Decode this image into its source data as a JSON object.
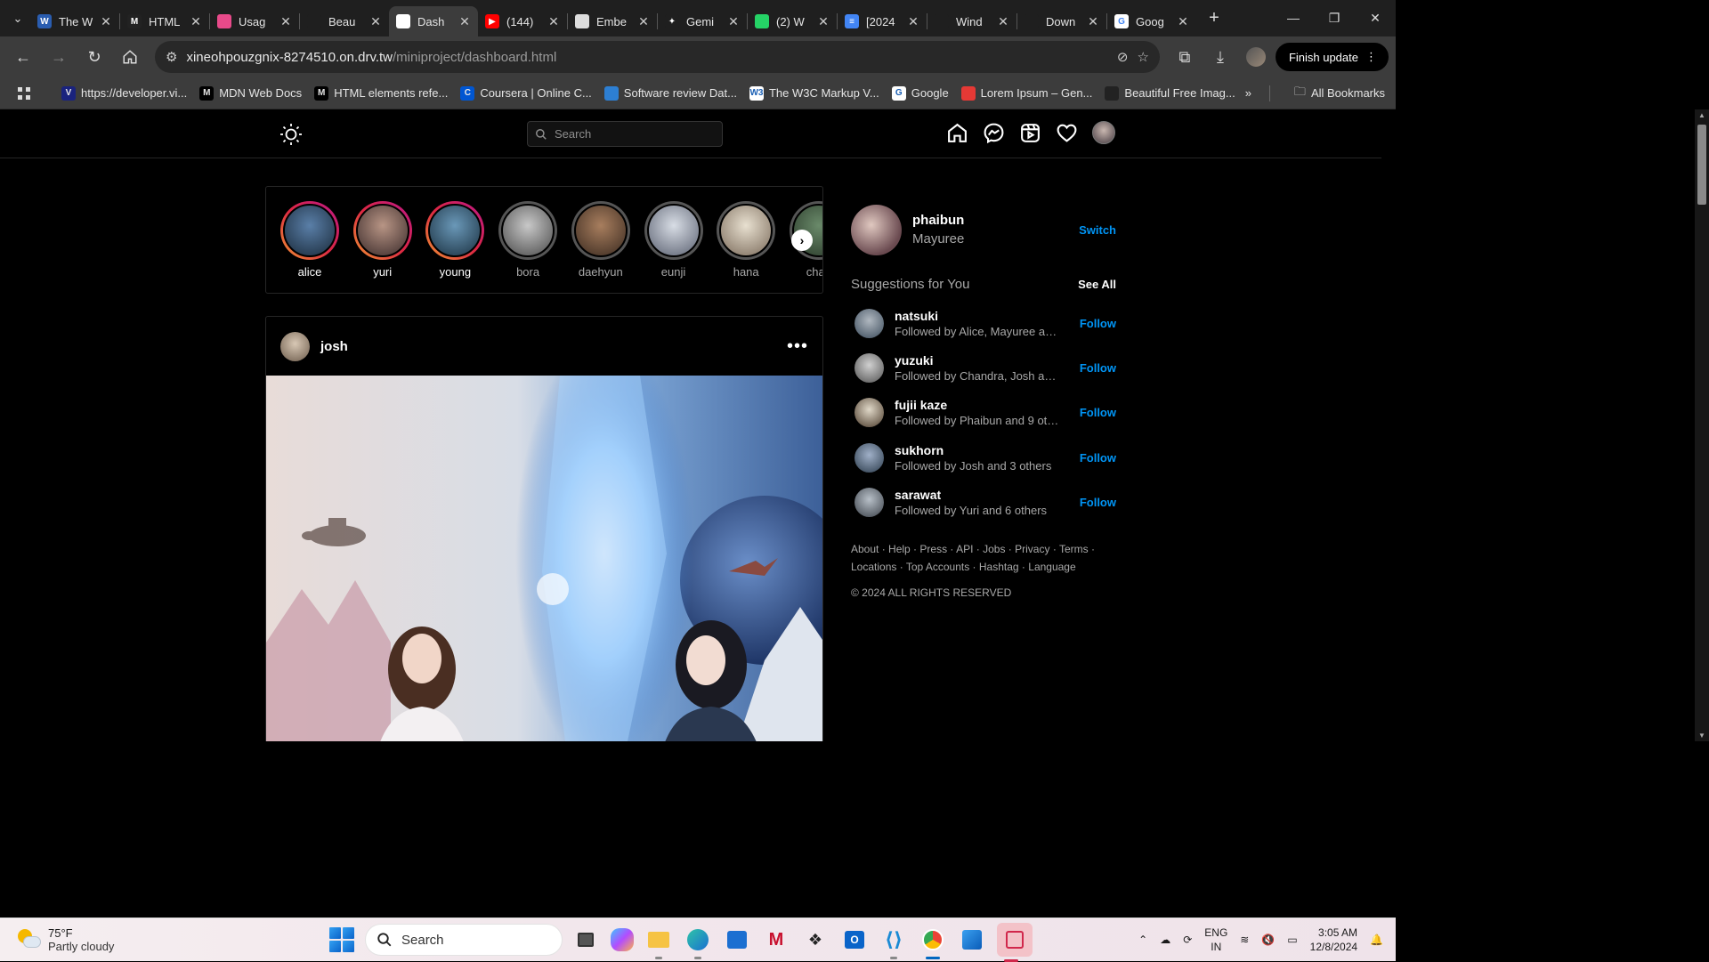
{
  "browser": {
    "tabs": [
      {
        "title": "The W",
        "fav": "W",
        "favcolor": "#2a5db0"
      },
      {
        "title": "HTML",
        "fav": "M",
        "favcolor": "#222"
      },
      {
        "title": "Usag",
        "fav": "",
        "favcolor": "#e84a8a"
      },
      {
        "title": "Beau",
        "fav": "",
        "favcolor": "#1f1f1f"
      },
      {
        "title": "Dash",
        "fav": "",
        "favcolor": "#fff",
        "active": true
      },
      {
        "title": "(144)",
        "fav": "▶",
        "favcolor": "#ff0000"
      },
      {
        "title": "Embe",
        "fav": "",
        "favcolor": "#ddd"
      },
      {
        "title": "Gemi",
        "fav": "✦",
        "favcolor": "#1f1f1f"
      },
      {
        "title": "(2) W",
        "fav": "",
        "favcolor": "#25d366"
      },
      {
        "title": "[2024",
        "fav": "≡",
        "favcolor": "#4285f4"
      },
      {
        "title": "Wind",
        "fav": "",
        "favcolor": "#1f1f1f"
      },
      {
        "title": "Down",
        "fav": "",
        "favcolor": "#1f1f1f"
      },
      {
        "title": "Goog",
        "fav": "G",
        "favcolor": "#fff"
      }
    ],
    "url_host": "xineohpouzgnix-8274510.on.drv.tw",
    "url_path": "/miniproject/dashboard.html",
    "finish_update": "Finish update",
    "bookmarks": [
      {
        "label": "https://developer.vi...",
        "fav": "V",
        "color": "#1a237e"
      },
      {
        "label": "MDN Web Docs",
        "fav": "M",
        "color": "#000"
      },
      {
        "label": "HTML elements refe...",
        "fav": "M",
        "color": "#000"
      },
      {
        "label": "Coursera | Online C...",
        "fav": "C",
        "color": "#0056d2"
      },
      {
        "label": "Software review Dat...",
        "fav": "",
        "color": "#2d7fd3"
      },
      {
        "label": "The W3C Markup V...",
        "fav": "W3",
        "color": "#fff"
      },
      {
        "label": "Google",
        "fav": "G",
        "color": "#fff"
      },
      {
        "label": "Lorem Ipsum – Gen...",
        "fav": "",
        "color": "#e53935"
      },
      {
        "label": "Beautiful Free Imag...",
        "fav": "",
        "color": "#222"
      }
    ],
    "all_bookmarks": "All Bookmarks"
  },
  "app": {
    "search_placeholder": "Search",
    "stories": [
      {
        "name": "alice",
        "seen": false,
        "c1": "#5a7fa8",
        "c2": "#1a2a3a"
      },
      {
        "name": "yuri",
        "seen": false,
        "c1": "#b89585",
        "c2": "#3a2a2a"
      },
      {
        "name": "young",
        "seen": false,
        "c1": "#6a98b8",
        "c2": "#1a3040"
      },
      {
        "name": "bora",
        "seen": true,
        "c1": "#c8c8c8",
        "c2": "#4a4a4a"
      },
      {
        "name": "daehyun",
        "seen": true,
        "c1": "#a87e5e",
        "c2": "#3a2a20"
      },
      {
        "name": "eunji",
        "seen": true,
        "c1": "#d8dde5",
        "c2": "#5a6070"
      },
      {
        "name": "hana",
        "seen": true,
        "c1": "#e8e0d0",
        "c2": "#7a6a5a"
      },
      {
        "name": "chan",
        "seen": true,
        "c1": "#6a8a6a",
        "c2": "#2a3a2a"
      }
    ],
    "post": {
      "user": "josh",
      "more": "•••"
    },
    "me": {
      "username": "phaibun",
      "name": "Mayuree",
      "switch": "Switch"
    },
    "suggestions_title": "Suggestions for You",
    "see_all": "See All",
    "suggestions": [
      {
        "user": "natsuki",
        "sub": "Followed by Alice, Mayuree and ...",
        "c1": "#b0b8c0",
        "c2": "#3a4a5a"
      },
      {
        "user": "yuzuki",
        "sub": "Followed by Chandra, Josh and ...",
        "c1": "#d0d0d0",
        "c2": "#505050"
      },
      {
        "user": "fujii kaze",
        "sub": "Followed by Phaibun and 9 others",
        "c1": "#e0d8c8",
        "c2": "#4a3a2a"
      },
      {
        "user": "sukhorn",
        "sub": "Followed by Josh and 3 others",
        "c1": "#a0b0c8",
        "c2": "#2a3a4a"
      },
      {
        "user": "sarawat",
        "sub": "Followed by Yuri and 6 others",
        "c1": "#b8c0c8",
        "c2": "#3a4048"
      }
    ],
    "follow": "Follow",
    "footer_links": [
      "About",
      "Help",
      "Press",
      "API",
      "Jobs",
      "Privacy",
      "Terms",
      "Locations",
      "Top Accounts",
      "Hashtag",
      "Language"
    ],
    "copyright": "© 2024 ALL RIGHTS RESERVED",
    "accent": "#0095f6"
  },
  "taskbar": {
    "temp": "75°F",
    "weather": "Partly cloudy",
    "search": "Search",
    "lang1": "ENG",
    "lang2": "IN",
    "time": "3:05 AM",
    "date": "12/8/2024"
  }
}
